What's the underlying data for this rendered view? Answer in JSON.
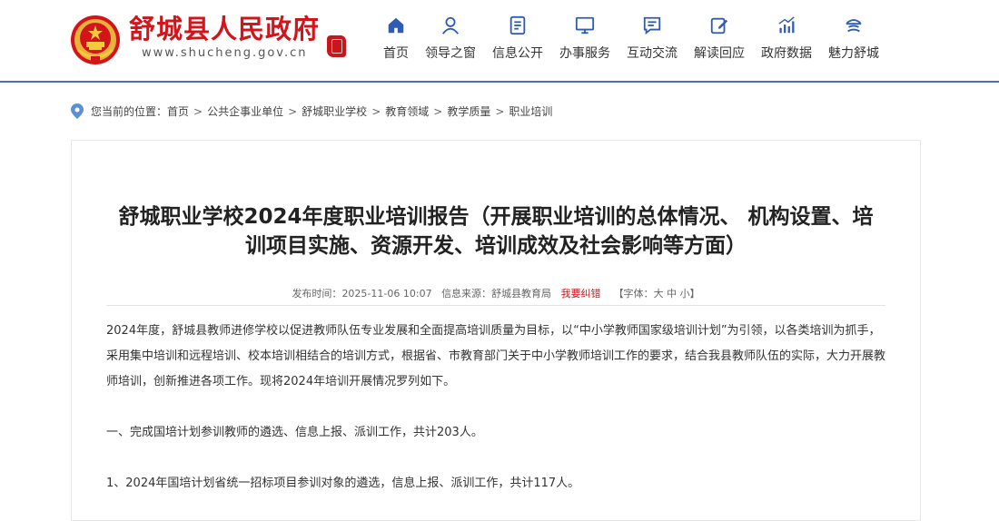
{
  "header": {
    "site_title": "舒城县人民政府",
    "site_url": "www.shucheng.gov.cn",
    "brand_color": "#d4141b",
    "accent_color": "#4a6fb5",
    "nav": [
      {
        "label": "首页",
        "icon": "home-icon"
      },
      {
        "label": "领导之窗",
        "icon": "person-icon"
      },
      {
        "label": "信息公开",
        "icon": "document-icon"
      },
      {
        "label": "办事服务",
        "icon": "monitor-icon"
      },
      {
        "label": "互动交流",
        "icon": "chat-icon"
      },
      {
        "label": "解读回应",
        "icon": "edit-icon"
      },
      {
        "label": "政府数据",
        "icon": "chart-icon"
      },
      {
        "label": "魅力舒城",
        "icon": "landmark-icon"
      }
    ]
  },
  "breadcrumb": {
    "prefix": "您当前的位置：",
    "items": [
      "首页",
      "公共企事业单位",
      "舒城职业学校",
      "教育领域",
      "教学质量",
      "职业培训"
    ],
    "separator": ">"
  },
  "article": {
    "title": "舒城职业学校2024年度职业培训报告（开展职业培训的总体情况、 机构设置、培训项目实施、资源开发、培训成效及社会影响等方面）",
    "meta": {
      "publish_label": "发布时间：",
      "publish_time": "2025-11-06 10:07",
      "source_label": "信息来源：",
      "source": "舒城县教育局",
      "correction": "我要纠错",
      "font_label": "【字体：",
      "font_large": "大",
      "font_medium": "中",
      "font_small": "小",
      "font_close": "】"
    },
    "paragraphs": [
      "2024年度，舒城县教师进修学校以促进教师队伍专业发展和全面提高培训质量为目标，以“中小学教师国家级培训计划”为引领，以各类培训为抓手，采用集中培训和远程培训、校本培训相结合的培训方式，根据省、市教育部门关于中小学教师培训工作的要求，结合我县教师队伍的实际，大力开展教师培训，创新推进各项工作。现将2024年培训开展情况罗列如下。",
      "一、完成国培计划参训教师的遴选、信息上报、派训工作，共计203人。",
      "1、2024年国培计划省统一招标项目参训对象的遴选，信息上报、派训工作，共计117人。"
    ]
  }
}
